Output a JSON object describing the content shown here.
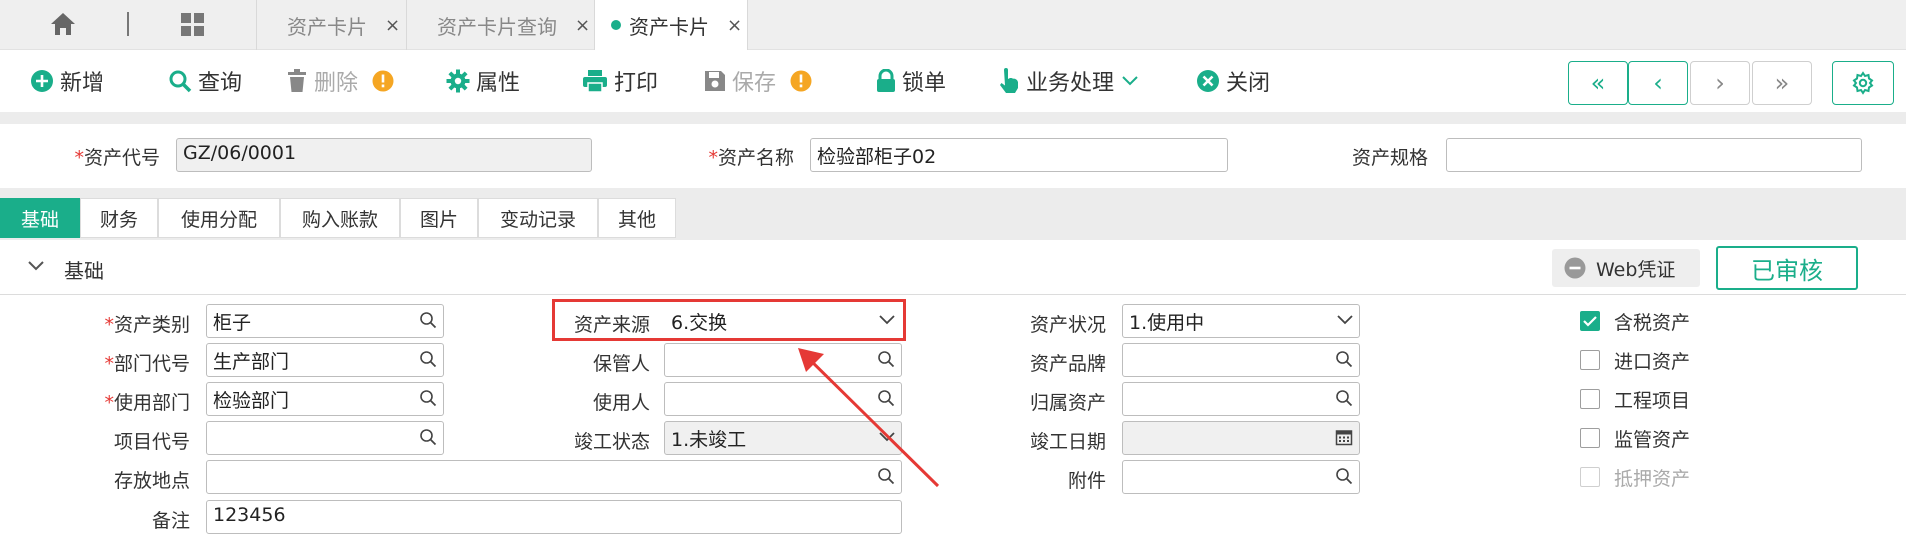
{
  "tabs": [
    {
      "label": "资产卡片",
      "close": "×"
    },
    {
      "label": "资产卡片查询",
      "close": "×"
    },
    {
      "label": "资产卡片",
      "close": "×"
    }
  ],
  "toolbar": {
    "add": "新增",
    "query": "查询",
    "delete": "删除",
    "properties": "属性",
    "print": "打印",
    "save": "保存",
    "lock": "锁单",
    "business": "业务处理",
    "close": "关闭",
    "nav_first": "«",
    "nav_prev": "‹",
    "nav_next": "›",
    "nav_last": "»"
  },
  "header": {
    "asset_code_label": "资产代号",
    "asset_code_value": "GZ/06/0001",
    "asset_name_label": "资产名称",
    "asset_name_value": "检验部柜子02",
    "asset_spec_label": "资产规格",
    "asset_spec_value": "",
    "required_mark": "*"
  },
  "subtabs": [
    "基础",
    "财务",
    "使用分配",
    "购入账款",
    "图片",
    "变动记录",
    "其他"
  ],
  "section": {
    "title": "基础",
    "web_voucher": "Web凭证",
    "status_badge": "已审核"
  },
  "form": {
    "asset_category_label": "资产类别",
    "asset_category_value": "柜子",
    "dept_code_label": "部门代号",
    "dept_code_value": "生产部门",
    "use_dept_label": "使用部门",
    "use_dept_value": "检验部门",
    "project_code_label": "项目代号",
    "project_code_value": "",
    "location_label": "存放地点",
    "location_value": "",
    "remark_label": "备注",
    "remark_value": "123456",
    "asset_source_label": "资产来源",
    "asset_source_value": "6.交换",
    "custodian_label": "保管人",
    "custodian_value": "",
    "user_label": "使用人",
    "user_value": "",
    "completion_status_label": "竣工状态",
    "completion_status_value": "1.未竣工",
    "asset_status_label": "资产状况",
    "asset_status_value": "1.使用中",
    "asset_brand_label": "资产品牌",
    "asset_brand_value": "",
    "belong_asset_label": "归属资产",
    "belong_asset_value": "",
    "completion_date_label": "竣工日期",
    "completion_date_value": "",
    "attachment_label": "附件",
    "attachment_value": ""
  },
  "checkboxes": [
    {
      "label": "含税资产",
      "checked": true,
      "disabled": false
    },
    {
      "label": "进口资产",
      "checked": false,
      "disabled": false
    },
    {
      "label": "工程项目",
      "checked": false,
      "disabled": false
    },
    {
      "label": "监管资产",
      "checked": false,
      "disabled": false
    },
    {
      "label": "抵押资产",
      "checked": false,
      "disabled": true
    }
  ],
  "colors": {
    "accent": "#1aae8a",
    "warning": "#f5a623",
    "highlight": "#e53935"
  }
}
